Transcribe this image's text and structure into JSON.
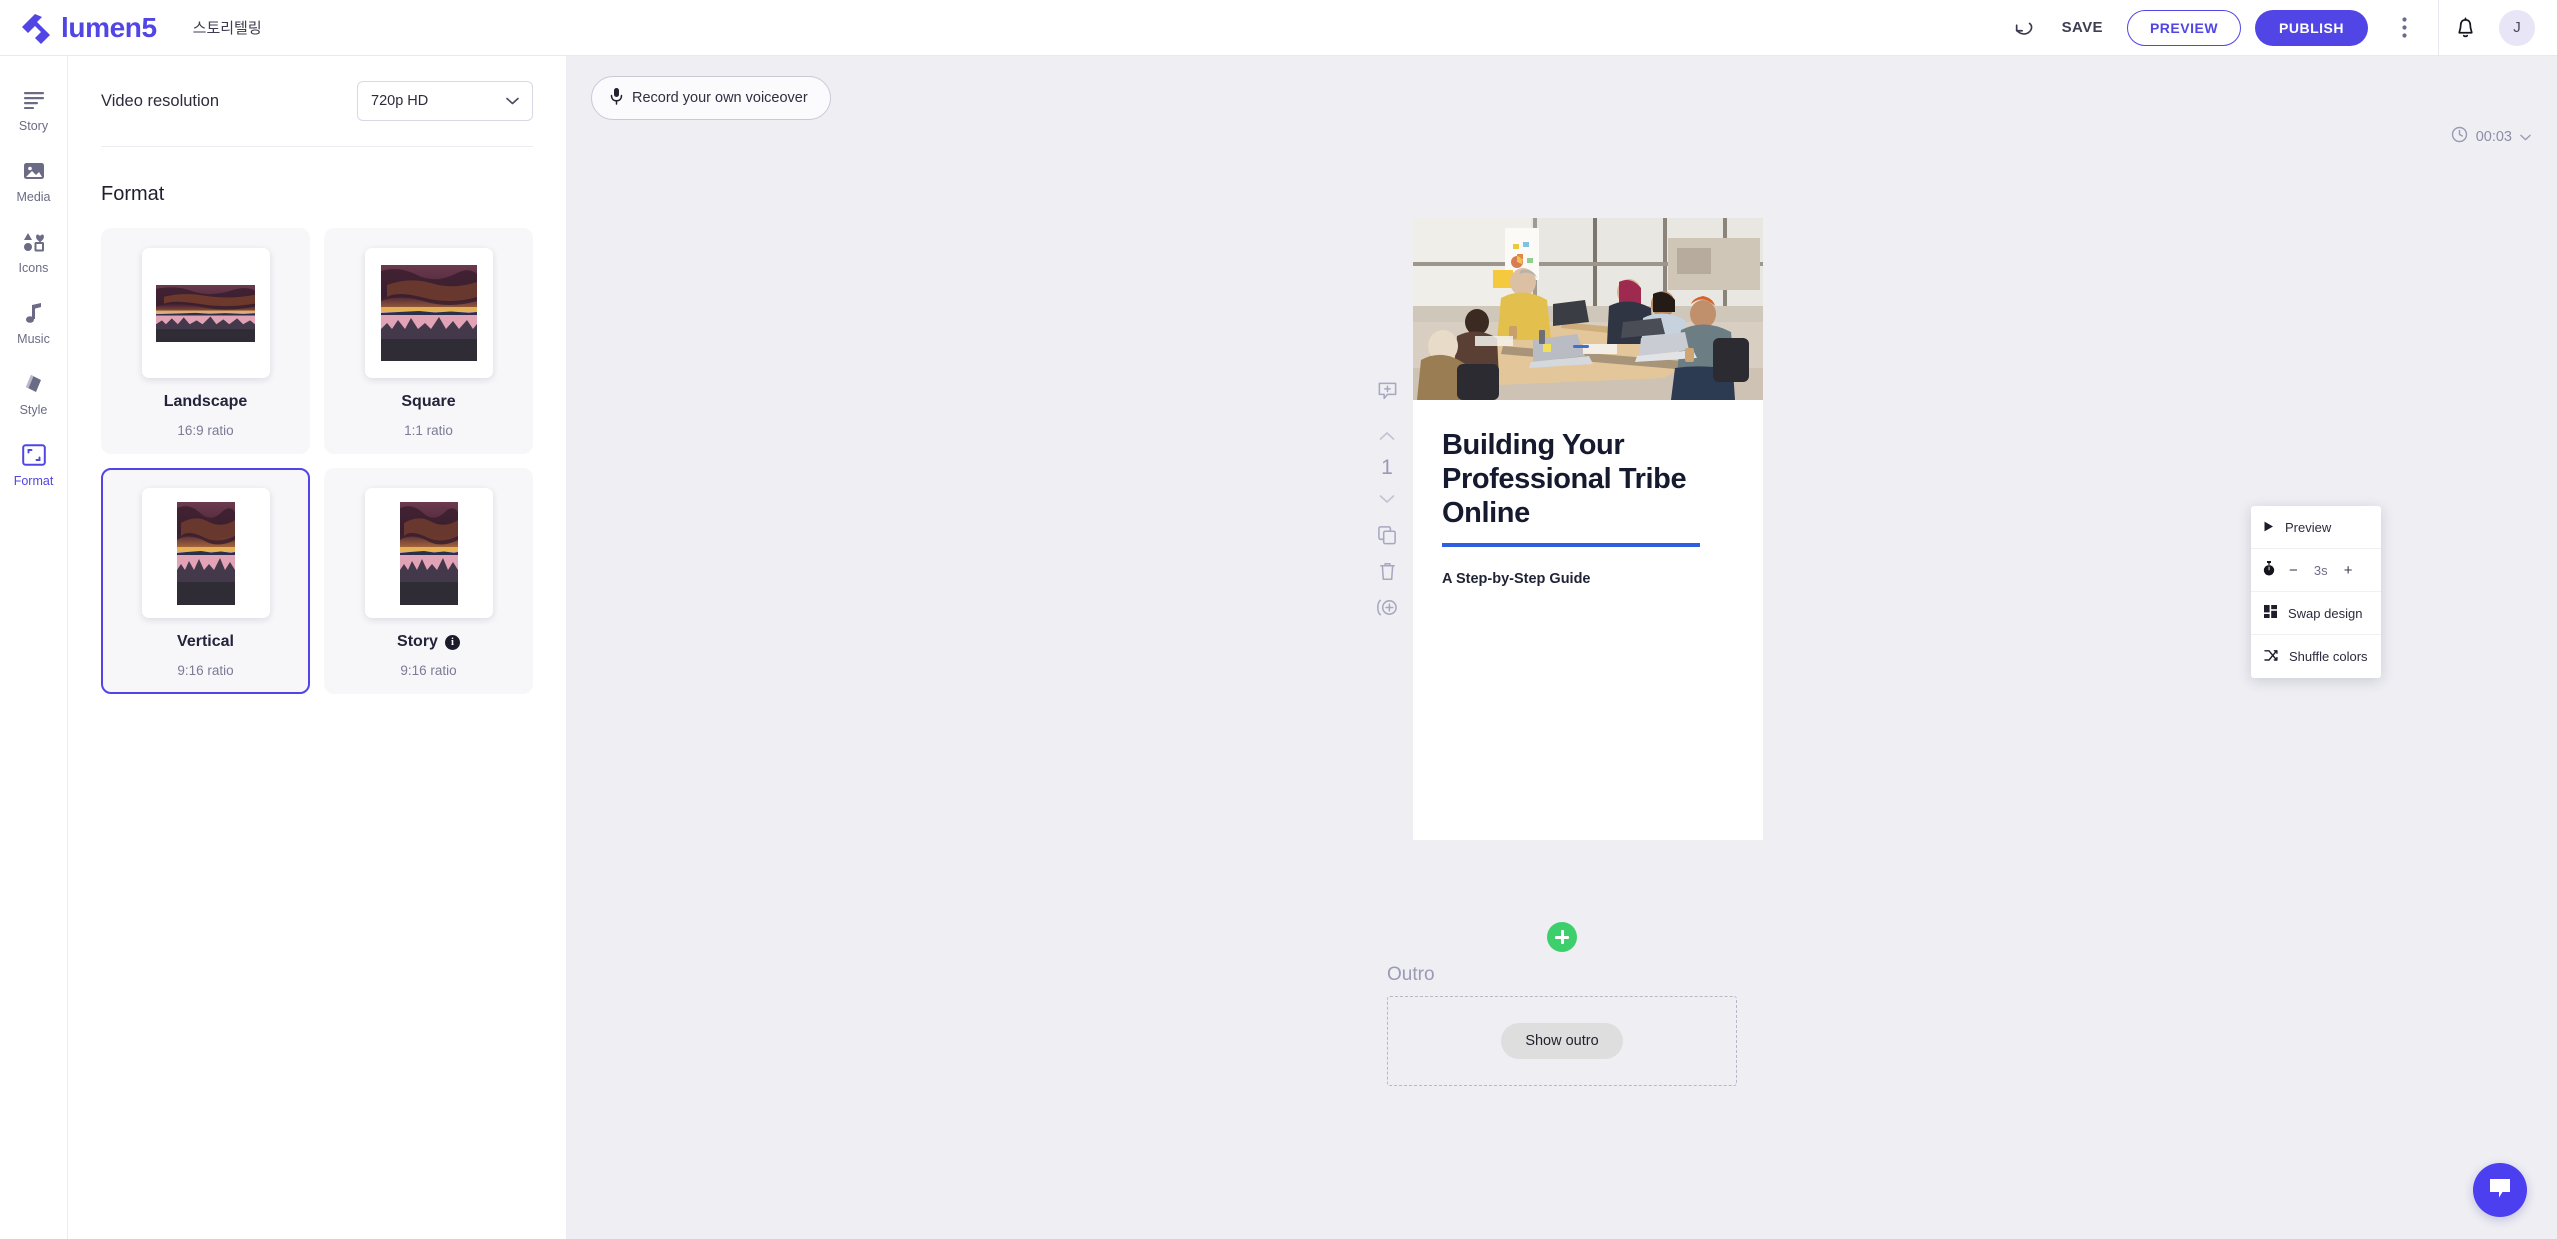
{
  "topbar": {
    "brand_name": "lumen5",
    "project_title": "스토리텔링",
    "undo_label": "undo",
    "save_label": "SAVE",
    "preview_label": "PREVIEW",
    "publish_label": "PUBLISH",
    "avatar_initial": "J",
    "accent_color": "#5146e5"
  },
  "nav": {
    "items": [
      {
        "label": "Story",
        "icon": "story-lines-icon",
        "active": false
      },
      {
        "label": "Media",
        "icon": "image-icon",
        "active": false
      },
      {
        "label": "Icons",
        "icon": "shapes-icon",
        "active": false
      },
      {
        "label": "Music",
        "icon": "music-note-icon",
        "active": false
      },
      {
        "label": "Style",
        "icon": "brush-layers-icon",
        "active": false
      },
      {
        "label": "Format",
        "icon": "crop-frame-icon",
        "active": true
      }
    ]
  },
  "panel": {
    "resolution_label": "Video resolution",
    "resolution_value": "720p HD",
    "format_heading": "Format",
    "formats": [
      {
        "name": "Landscape",
        "ratio": "16:9 ratio",
        "shape": "landscape",
        "selected": false,
        "info": false
      },
      {
        "name": "Square",
        "ratio": "1:1 ratio",
        "shape": "square",
        "selected": false,
        "info": false
      },
      {
        "name": "Vertical",
        "ratio": "9:16 ratio",
        "shape": "vertical",
        "selected": true,
        "info": false
      },
      {
        "name": "Story",
        "ratio": "9:16 ratio",
        "shape": "vertical",
        "selected": false,
        "info": true
      }
    ]
  },
  "canvas": {
    "voiceover_label": "Record your own voiceover",
    "duration": "00:03",
    "scene_number": "1",
    "scene_title": "Building Your Professional Tribe Online",
    "scene_subtitle": "A Step-by-Step Guide",
    "outro_label": "Outro",
    "outro_button": "Show outro",
    "add_scene_label": "Add scene"
  },
  "context_menu": {
    "preview": "Preview",
    "timer_minus": "−",
    "timer_value": "3s",
    "timer_plus": "+",
    "swap_design": "Swap design",
    "shuffle_colors": "Shuffle colors"
  }
}
